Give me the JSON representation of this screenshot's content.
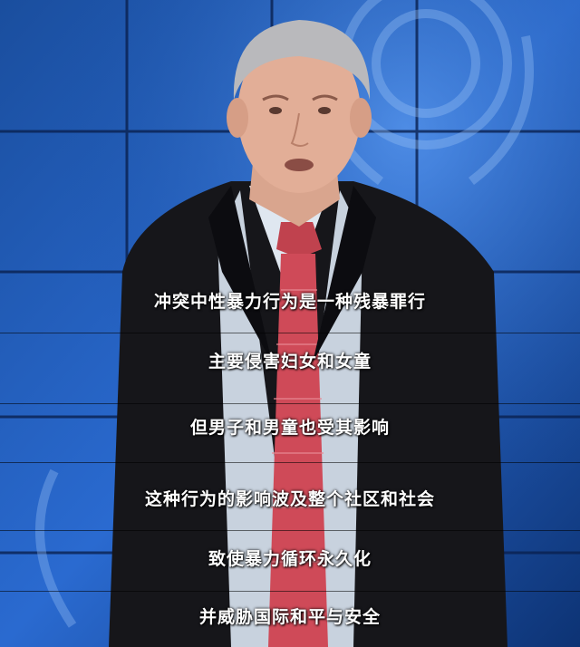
{
  "subtitles": [
    "冲突中性暴力行为是一种残暴罪行",
    "主要侵害妇女和女童",
    "但男子和男童也受其影响",
    "这种行为的影响波及整个社区和社会",
    "致使暴力循环永久化",
    "并威胁国际和平与安全"
  ]
}
